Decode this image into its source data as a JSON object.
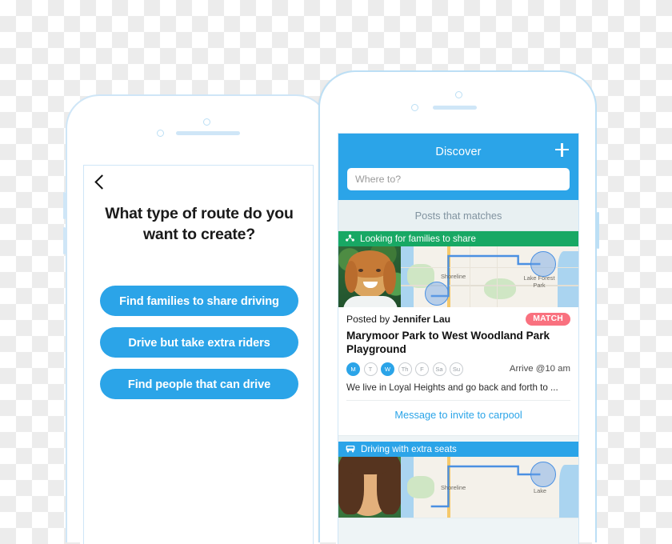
{
  "left_phone": {
    "back_icon": "chevron-left-icon",
    "question": "What type of route do you want to create?",
    "options": [
      "Find families to share driving",
      "Drive but take extra riders",
      "Find people that can drive"
    ]
  },
  "right_phone": {
    "header": {
      "title": "Discover",
      "add_icon": "plus-icon"
    },
    "search": {
      "placeholder": "Where to?",
      "value": ""
    },
    "section_label": "Posts that matches",
    "cards": [
      {
        "banner_label": "Looking for families to share",
        "banner_icon": "people-group-icon",
        "banner_color": "#18a864",
        "posted_prefix": "Posted by ",
        "poster_name": "Jennifer Lau",
        "badge": "MATCH",
        "badge_color": "#f9717f",
        "route_title": "Marymoor Park to West Woodland Park Playground",
        "days": [
          {
            "label": "M",
            "active": true
          },
          {
            "label": "T",
            "active": false
          },
          {
            "label": "W",
            "active": true
          },
          {
            "label": "Th",
            "active": false
          },
          {
            "label": "F",
            "active": false
          },
          {
            "label": "Sa",
            "active": false
          },
          {
            "label": "Su",
            "active": false
          }
        ],
        "arrive": "Arrive @10 am",
        "description": "We live in Loyal Heights and go back and forth to ...",
        "cta": "Message to invite to carpool",
        "map_labels": [
          "Shoreline",
          "Lake Forest Park"
        ]
      },
      {
        "banner_label": "Driving with extra seats",
        "banner_icon": "car-icon",
        "banner_color": "#2ba4e8",
        "map_labels": [
          "Shoreline",
          "Lake"
        ]
      }
    ]
  },
  "theme": {
    "accent_blue": "#2ba4e8",
    "green": "#18a864",
    "pink": "#f9717f",
    "frame_outline": "#cfe6f7",
    "band_bg": "#e8f0f2"
  }
}
